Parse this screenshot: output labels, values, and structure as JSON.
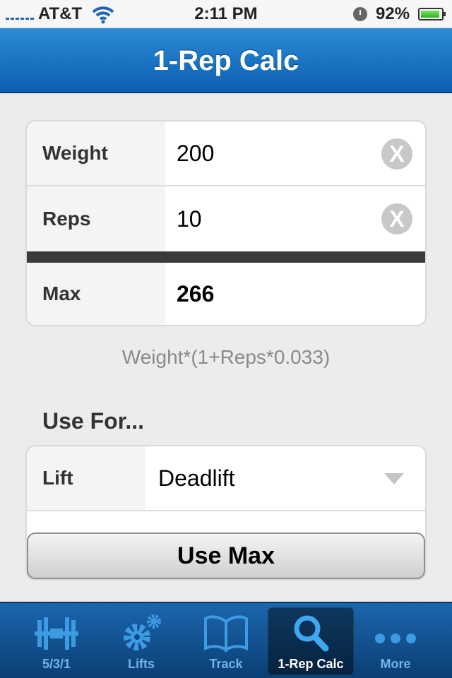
{
  "status_bar": {
    "carrier": "AT&T",
    "time": "2:11 PM",
    "battery": "92%",
    "battery_level": 0.92,
    "icons": [
      "signal-icon",
      "wifi-icon",
      "clock-icon",
      "battery-icon"
    ]
  },
  "nav": {
    "title": "1-Rep Calc"
  },
  "calc": {
    "weight_label": "Weight",
    "weight_value": "200",
    "reps_label": "Reps",
    "reps_value": "10",
    "max_label": "Max",
    "max_value": "266",
    "clear_icon": "X"
  },
  "formula": "Weight*(1+Reps*0.033)",
  "use_for": {
    "title": "Use For...",
    "lift_label": "Lift",
    "lift_value": "Deadlift",
    "button": "Use Max"
  },
  "tabs": [
    {
      "label": "5/3/1",
      "icon": "barbell-icon"
    },
    {
      "label": "Lifts",
      "icon": "gears-icon"
    },
    {
      "label": "Track",
      "icon": "book-icon"
    },
    {
      "label": "1-Rep Calc",
      "icon": "search-icon",
      "active": true
    },
    {
      "label": "More",
      "icon": "more-icon"
    }
  ],
  "colors": {
    "accent": "#1a74c6",
    "tab_icon": "#3d9be3"
  }
}
